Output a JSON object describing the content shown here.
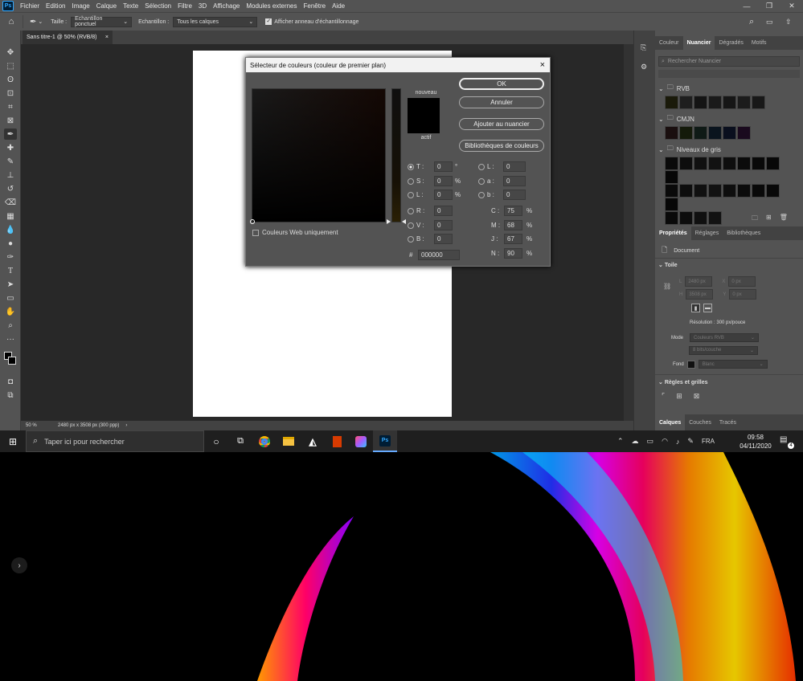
{
  "app": {
    "badge": "Ps"
  },
  "menu": [
    "Fichier",
    "Edition",
    "Image",
    "Calque",
    "Texte",
    "Sélection",
    "Filtre",
    "3D",
    "Affichage",
    "Modules externes",
    "Fenêtre",
    "Aide"
  ],
  "options": {
    "size_label": "Taille :",
    "size_value": "Echantillon ponctuel",
    "sample_label": "Echantillon :",
    "sample_value": "Tous les calques",
    "ring_label": "Afficher anneau d'échantillonnage"
  },
  "document": {
    "tab_title": "Sans titre-1 @ 50% (RVB/8)",
    "zoom": "50 %",
    "dimensions": "2480 px x 3508 px (300 ppp)"
  },
  "swatches_panel": {
    "tabs": [
      "Couleur",
      "Nuancier",
      "Dégradés",
      "Motifs"
    ],
    "search_placeholder": "Rechercher Nuancier",
    "groups": [
      "RVB",
      "CMJN",
      "Niveaux de gris"
    ],
    "rvb_colors": [
      "#1a1a0a",
      "#1e1e1e",
      "#141414",
      "#1a1a1a",
      "#161616",
      "#1c1c1c",
      "#181818"
    ],
    "cmjn_colors": [
      "#1a0f0f",
      "#141a0a",
      "#0f1a16",
      "#0a141e",
      "#0a0f1e",
      "#1a0a1e"
    ],
    "grey_colors": [
      "#0a0a0a",
      "#0d0d0d",
      "#101010",
      "#121212",
      "#0e0e0e",
      "#0b0b0b",
      "#090909",
      "#080808",
      "#070707"
    ]
  },
  "properties_panel": {
    "tabs": [
      "Propriétés",
      "Réglages",
      "Bibliothèques"
    ],
    "doc_label": "Document",
    "section_canvas": "Toile",
    "w": "2480 px",
    "x": "0 px",
    "h": "3508 px",
    "y": "0 px",
    "resolution": "Résolution : 300 px/pouce",
    "mode_label": "Mode",
    "mode_value": "Couleurs RVB",
    "bits_value": "8 bits/couche",
    "fond_label": "Fond",
    "fond_value": "Blanc",
    "section_rules": "Règles et grilles"
  },
  "bottom_panel": {
    "tabs": [
      "Calques",
      "Couches",
      "Tracés"
    ]
  },
  "dialog": {
    "title": "Sélecteur de couleurs (couleur de premier plan)",
    "close": "×",
    "new_label": "nouveau",
    "current_label": "actif",
    "ok": "OK",
    "cancel": "Annuler",
    "add_swatch": "Ajouter au nuancier",
    "libraries": "Bibliothèques de couleurs",
    "web_only": "Couleurs Web uniquement",
    "T": "0",
    "S": "0",
    "L": "0",
    "R": "0",
    "V": "0",
    "B": "0",
    "Lab_L": "0",
    "Lab_a": "0",
    "Lab_b": "0",
    "C": "75",
    "M": "68",
    "J": "67",
    "N": "90",
    "hex": "000000",
    "labels": {
      "T": "T :",
      "S": "S :",
      "L": "L :",
      "R": "R :",
      "V": "V :",
      "B": "B :",
      "Lab_L": "L :",
      "Lab_a": "a :",
      "Lab_b": "b :",
      "C": "C :",
      "M": "M :",
      "J": "J :",
      "N": "N :",
      "hash": "#",
      "deg": "°",
      "pct": "%"
    }
  },
  "taskbar": {
    "search_placeholder": "Taper ici pour rechercher",
    "lang": "FRA",
    "time": "09:58",
    "date": "04/11/2020",
    "notif": "4"
  }
}
